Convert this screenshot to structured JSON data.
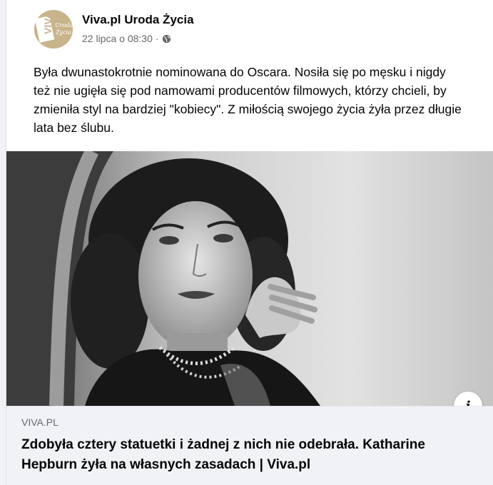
{
  "post": {
    "page_name": "Viva.pl Uroda Życia",
    "timestamp": "22 lipca o 08:30",
    "separator": "·",
    "privacy_icon": "globe-icon",
    "avatar_logo": {
      "main": "VIVA!",
      "sub": "Uroda Życia"
    },
    "text": "Była dwunastokrotnie nominowana do Oscara. Nosiła się po męsku i nigdy też nie ugięła się pod namowami producentów filmowych, którzy chcieli, by zmieniła styl na bardziej \"kobiecy\". Z miłością swojego życia żyła przez długie lata bez ślubu."
  },
  "link_preview": {
    "domain": "VIVA.PL",
    "title": "Zdobyła cztery statuetki i żadnej z nich nie odebrała. Katharine Hepburn żyła na własnych zasadach | Viva.pl",
    "info_icon": "info-icon",
    "info_label": "i"
  },
  "colors": {
    "avatar_bg": "#c8b48a",
    "secondary_text": "#65676b",
    "link_box_bg": "#f0f2f5"
  }
}
